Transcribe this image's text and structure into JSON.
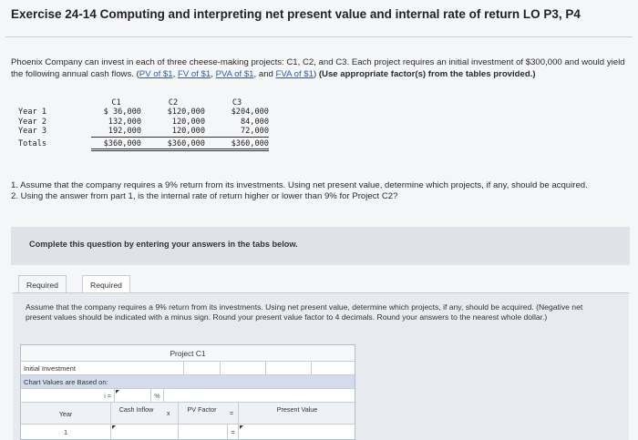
{
  "title": "Exercise 24-14 Computing and interpreting net present value and internal rate of return LO P3, P4",
  "intro": {
    "text_before": "Phoenix Company can invest in each of three cheese-making projects: C1, C2, and C3. Each project requires an initial investment of $300,000 and would yield the following annual cash flows. (",
    "links": [
      "PV of $1",
      "FV of $1",
      "PVA of $1",
      "FVA of $1"
    ],
    "sep1": ", ",
    "sep2": ", ",
    "sep3": ", and ",
    "text_after": ") ",
    "bold_text": "(Use appropriate factor(s) from the tables provided.)"
  },
  "cash_flows": {
    "headers": [
      "C1",
      "C2",
      "C3"
    ],
    "rows": [
      {
        "label": "Year 1",
        "c1": "$ 36,000",
        "c2": "$120,000",
        "c3": "$204,000"
      },
      {
        "label": "Year 2",
        "c1": "132,000",
        "c2": "120,000",
        "c3": "84,000"
      },
      {
        "label": "Year 3",
        "c1": "192,000",
        "c2": "120,000",
        "c3": "72,000"
      }
    ],
    "totals": {
      "label": "Totals",
      "c1": "$360,000",
      "c2": "$360,000",
      "c3": "$360,000"
    }
  },
  "questions": {
    "q1": "1. Assume that the company requires a 9% return from its investments. Using net present value, determine which projects, if any, should be acquired.",
    "q2": "2. Using the answer from part 1, is the internal rate of return higher or lower than 9% for Project C2?"
  },
  "complete_box": "Complete this question by entering your answers in the tabs below.",
  "tabs": [
    {
      "label": "Required 1"
    },
    {
      "label": "Required 2"
    }
  ],
  "instructions": "Assume that the company requires a 9% return from its investments. Using net present value, determine which projects, if any, should be acquired. (Negative net present values should be indicated with a minus sign. Round your present value factor to 4 decimals. Round your answers to the nearest whole dollar.)",
  "grid": {
    "title": "Project C1",
    "initial_investment_label": "Initial Investment",
    "chart_values_label": "Chart Values are Based on:",
    "i_label": "i =",
    "percent": "%",
    "headers": {
      "year": "Year",
      "cash_inflow": "Cash Inflow",
      "pv_factor": "PV Factor",
      "present_value": "Present Value",
      "times": "x",
      "equals": "="
    },
    "first_year": "1",
    "row_equals": "="
  },
  "colors": {
    "link": "#2b5aa6",
    "chart_row_bg": "#d3dcea",
    "panel_bg": "#e7eaee"
  }
}
